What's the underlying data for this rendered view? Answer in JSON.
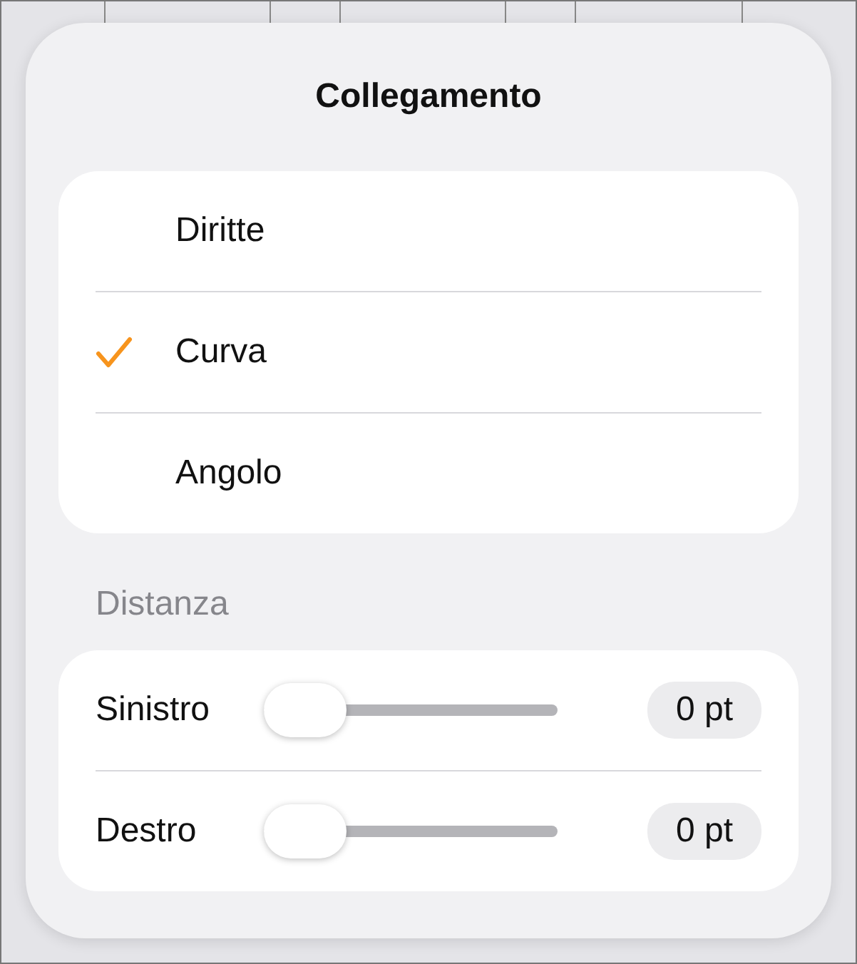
{
  "popover": {
    "title": "Collegamento",
    "options": [
      {
        "label": "Diritte",
        "selected": false
      },
      {
        "label": "Curva",
        "selected": true
      },
      {
        "label": "Angolo",
        "selected": false
      }
    ],
    "section_header": "Distanza",
    "sliders": [
      {
        "label": "Sinistro",
        "level": 0,
        "reading": "0 pt"
      },
      {
        "label": "Destro",
        "level": 0,
        "reading": "0 pt"
      }
    ]
  }
}
